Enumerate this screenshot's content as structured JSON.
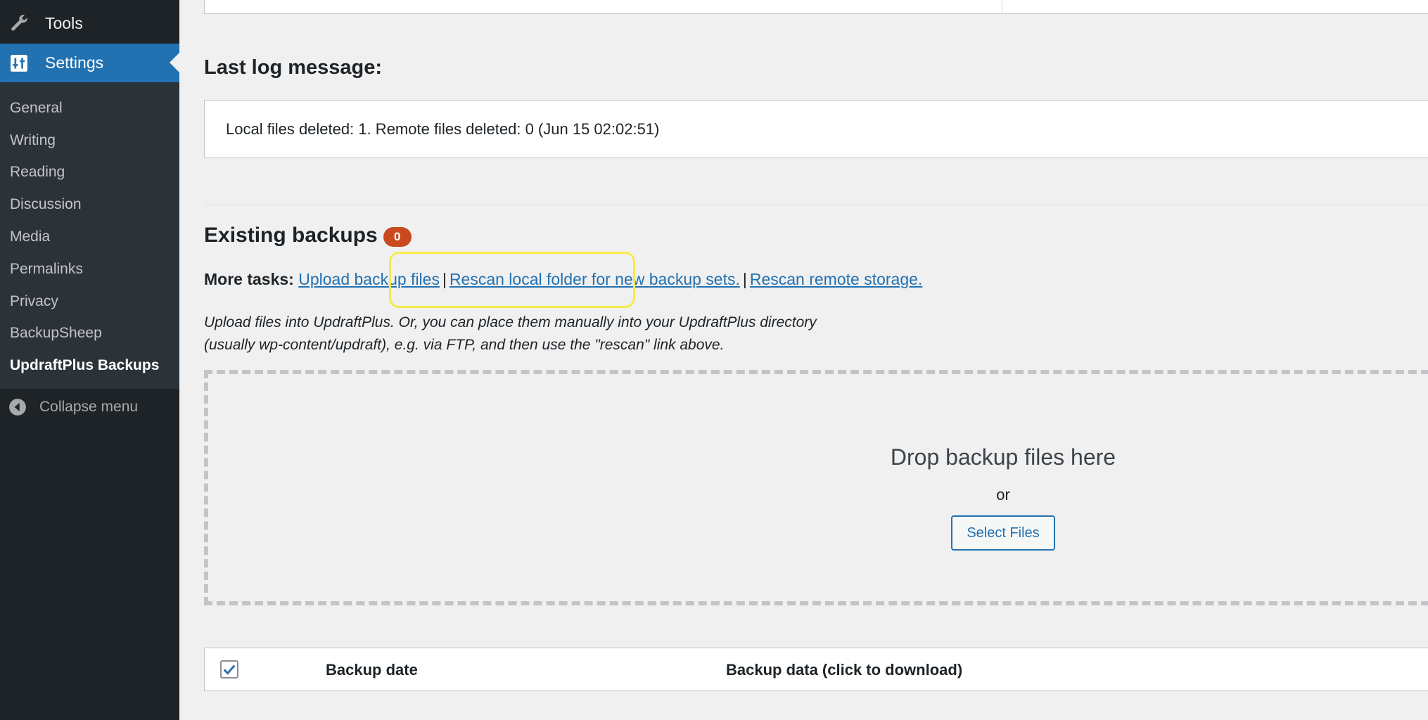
{
  "sidebar": {
    "tools_label": "Tools",
    "settings_label": "Settings",
    "items": [
      {
        "label": "General"
      },
      {
        "label": "Writing"
      },
      {
        "label": "Reading"
      },
      {
        "label": "Discussion"
      },
      {
        "label": "Media"
      },
      {
        "label": "Permalinks"
      },
      {
        "label": "Privacy"
      },
      {
        "label": "BackupSheep"
      },
      {
        "label": "UpdraftPlus Backups"
      }
    ],
    "collapse_label": "Collapse menu"
  },
  "log": {
    "heading": "Last log message:",
    "message": "Local files deleted: 1. Remote files deleted: 0 (Jun 15 02:02:51)"
  },
  "backups": {
    "heading": "Existing backups",
    "count": "0",
    "tasks_label": "More tasks:",
    "upload_link": "Upload backup files",
    "rescan_local_link": "Rescan local folder for new backup sets.",
    "rescan_remote_link": "Rescan remote storage.",
    "separator": "|",
    "note_line1": "Upload files into UpdraftPlus. Or, you can place them manually into your UpdraftPlus directory",
    "note_line2": "(usually wp-content/updraft), e.g. via FTP, and then use the \"rescan\" link above."
  },
  "dropzone": {
    "title": "Drop backup files here",
    "or": "or",
    "button": "Select Files"
  },
  "table": {
    "col_date": "Backup date",
    "col_data": "Backup data (click to download)"
  },
  "colors": {
    "accent": "#2271b1",
    "sidebar_bg": "#1d2327",
    "badge": "#ca4a1f",
    "highlight": "#f5e94a"
  }
}
